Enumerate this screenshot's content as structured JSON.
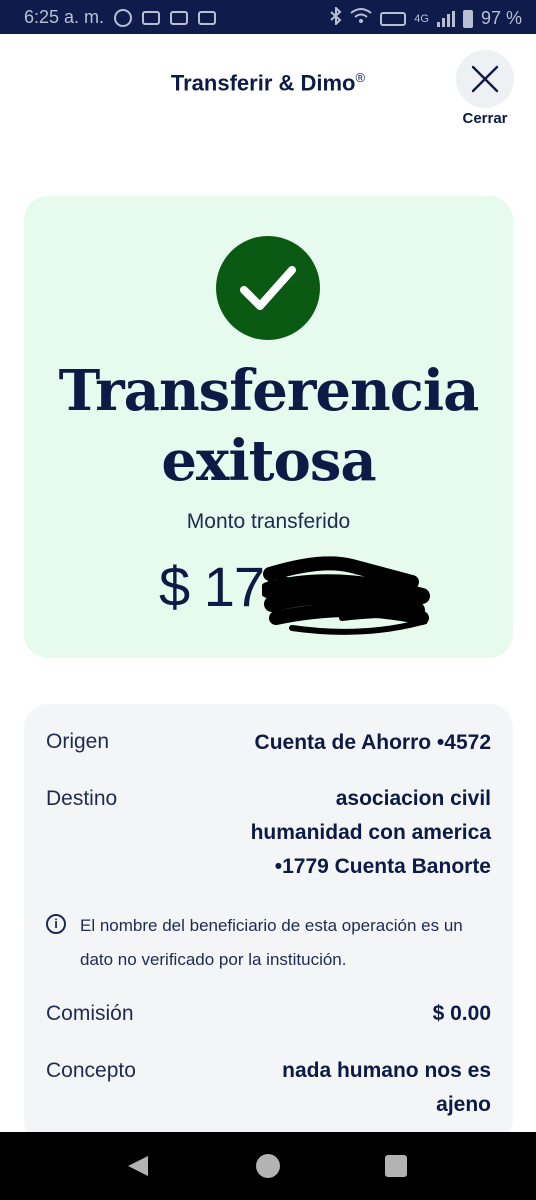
{
  "status_bar": {
    "time": "6:25 a. m.",
    "network": "4G",
    "battery": "97 %"
  },
  "header": {
    "title": "Transferir & Dimo",
    "registered_mark": "®",
    "close_label": "Cerrar"
  },
  "success": {
    "title_line1": "Transferencia",
    "title_line2": "exitosa",
    "amount_label": "Monto transferido",
    "amount_visible": "$ 175"
  },
  "details": {
    "origin_label": "Origen",
    "origin_value": "Cuenta de Ahorro •4572",
    "destination_label": "Destino",
    "destination_lines": [
      "asociacion civil",
      "humanidad con america",
      "•1779 Cuenta Banorte"
    ],
    "info_text": "El nombre del beneficiario de esta operación es un dato no verificado por la institución.",
    "fee_label": "Comisión",
    "fee_value": "$ 0.00",
    "concept_label": "Concepto",
    "concept_lines": [
      "nada humano nos es",
      "ajeno"
    ]
  },
  "colors": {
    "navy": "#0c1a45",
    "success_bg": "#e6fbee",
    "check_green": "#0b5a14",
    "details_bg": "#f4f5f7"
  },
  "icons": {
    "close": "close-x-icon",
    "check": "checkmark-icon",
    "info": "info-icon"
  }
}
